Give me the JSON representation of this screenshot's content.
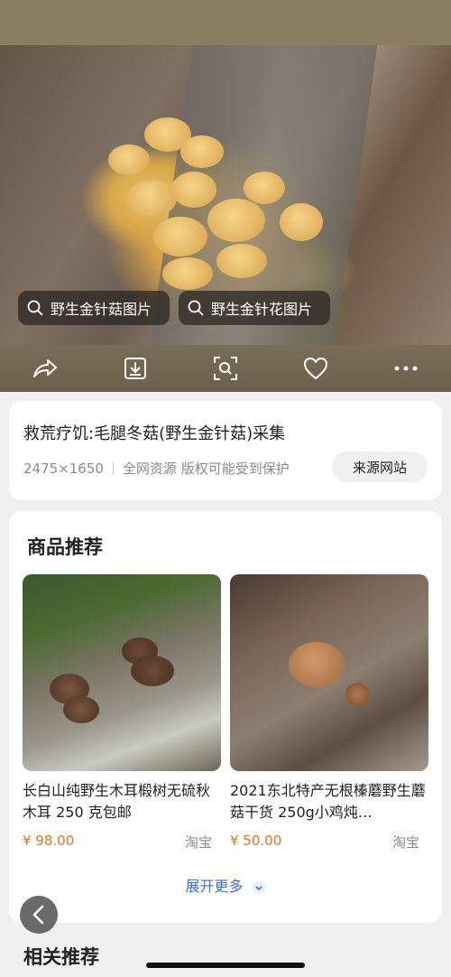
{
  "hero": {
    "chips": [
      {
        "label": "野生金针菇图片"
      },
      {
        "label": "野生金针花图片"
      }
    ]
  },
  "toolbar": {
    "icons": [
      "share-icon",
      "download-icon",
      "visual-search-icon",
      "heart-icon",
      "more-icon"
    ]
  },
  "info": {
    "title": "救荒疗饥:毛腿冬菇(野生金针菇)采集",
    "dimensions": "2475×1650",
    "source_note": "全网资源 版权可能受到保护",
    "source_button": "来源网站"
  },
  "products": {
    "title": "商品推荐",
    "items": [
      {
        "name": "长白山纯野生木耳椴树无硫秋木耳 250 克包邮",
        "price": "¥ 98.00",
        "shop": "淘宝"
      },
      {
        "name": "2021东北特产无根榛蘑野生蘑菇干货 250g小鸡炖…",
        "price": "¥ 50.00",
        "shop": "淘宝"
      }
    ],
    "expand_label": "展开更多"
  },
  "related": {
    "title": "相关推荐"
  },
  "colors": {
    "accent_blue": "#3a6fd8",
    "price_orange": "#e8741a"
  }
}
